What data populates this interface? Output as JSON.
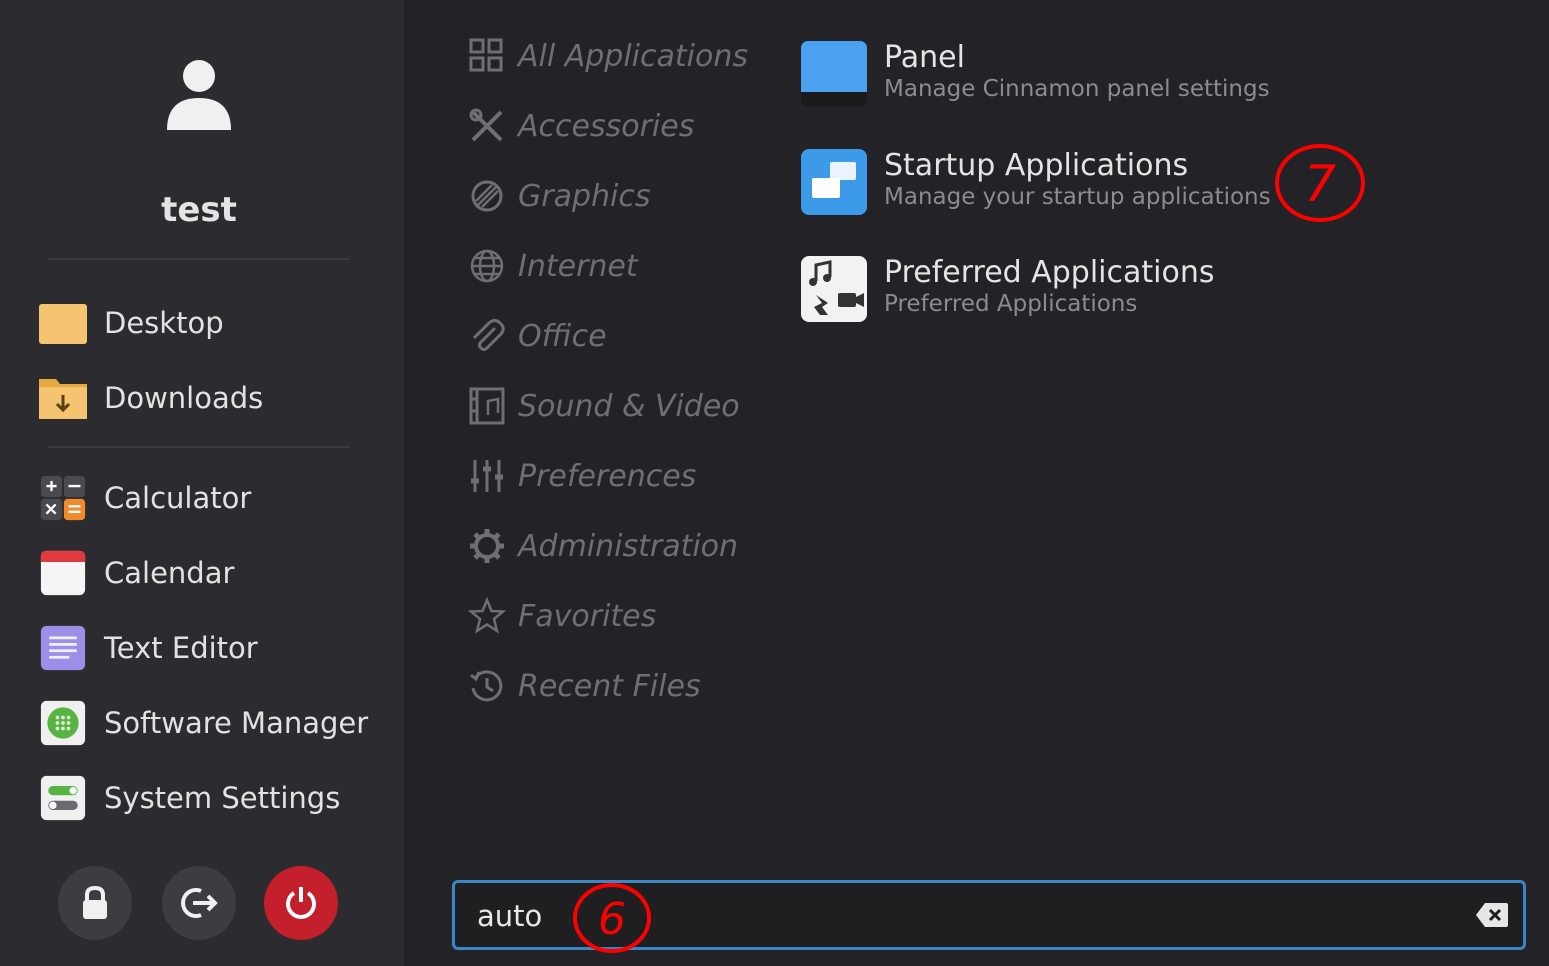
{
  "user": {
    "name": "test"
  },
  "places": [
    {
      "label": "Desktop",
      "icon": "folder-icon"
    },
    {
      "label": "Downloads",
      "icon": "downloads-folder-icon"
    }
  ],
  "favorites": [
    {
      "label": "Calculator",
      "icon": "calculator-icon"
    },
    {
      "label": "Calendar",
      "icon": "calendar-icon"
    },
    {
      "label": "Text Editor",
      "icon": "text-editor-icon"
    },
    {
      "label": "Software Manager",
      "icon": "software-manager-icon"
    },
    {
      "label": "System Settings",
      "icon": "system-settings-icon"
    }
  ],
  "system_buttons": [
    "lock-icon",
    "logout-icon",
    "power-icon"
  ],
  "categories": [
    {
      "label": "All Applications",
      "icon": "grid-icon"
    },
    {
      "label": "Accessories",
      "icon": "tools-icon"
    },
    {
      "label": "Graphics",
      "icon": "graphics-icon"
    },
    {
      "label": "Internet",
      "icon": "globe-icon"
    },
    {
      "label": "Office",
      "icon": "paperclip-icon"
    },
    {
      "label": "Sound & Video",
      "icon": "media-icon"
    },
    {
      "label": "Preferences",
      "icon": "sliders-icon"
    },
    {
      "label": "Administration",
      "icon": "gear-icon"
    },
    {
      "label": "Favorites",
      "icon": "star-icon"
    },
    {
      "label": "Recent Files",
      "icon": "history-icon"
    }
  ],
  "results": [
    {
      "name": "Panel",
      "description": "Manage Cinnamon panel settings",
      "icon": "panel-icon"
    },
    {
      "name": "Startup Applications",
      "description": "Manage your startup applications",
      "icon": "startup-applications-icon"
    },
    {
      "name": "Preferred Applications",
      "description": "Preferred Applications",
      "icon": "preferred-applications-icon"
    }
  ],
  "search": {
    "value": "auto"
  },
  "annotations": {
    "step_search": "6",
    "step_startup": "7"
  },
  "colors": {
    "accent": "#3b86c4",
    "power": "#c4202b",
    "annotation": "#ff0000"
  }
}
